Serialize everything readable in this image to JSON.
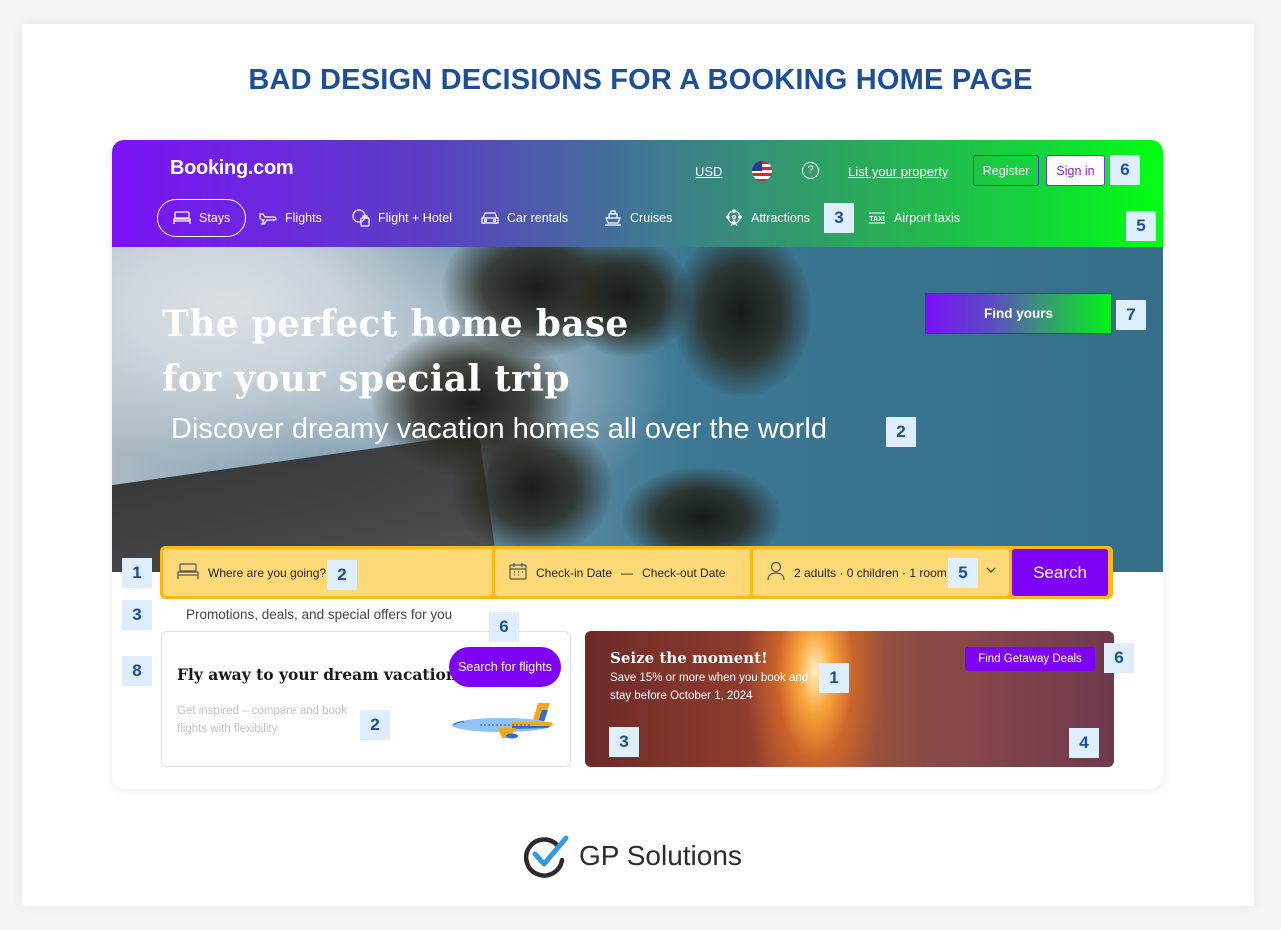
{
  "page_title": "BAD DESIGN DECISIONS FOR A BOOKING HOME PAGE",
  "header": {
    "logo": "Booking.com",
    "currency": "USD",
    "language_icon": "us-flag-icon",
    "help_icon": "question-circle-icon",
    "help_glyph": "?",
    "list_property": "List your property",
    "register": "Register",
    "sign_in": "Sign in"
  },
  "nav": {
    "items": [
      {
        "label": "Stays",
        "icon": "bed-icon",
        "active": true
      },
      {
        "label": "Flights",
        "icon": "plane-icon",
        "active": false
      },
      {
        "label": "Flight + Hotel",
        "icon": "flight-hotel-icon",
        "active": false
      },
      {
        "label": "Car rentals",
        "icon": "car-icon",
        "active": false
      },
      {
        "label": "Cruises",
        "icon": "ship-icon",
        "active": false
      },
      {
        "label": "Attractions",
        "icon": "ferris-wheel-icon",
        "active": false
      },
      {
        "label": "Airport taxis",
        "icon": "taxi-icon",
        "active": false
      }
    ]
  },
  "hero": {
    "headline_line1": "The perfect home base",
    "headline_line2": "for your special trip",
    "subtitle": "Discover dreamy vacation homes all over the world",
    "cta": "Find yours"
  },
  "search": {
    "destination_placeholder": "Where are you going?",
    "checkin_placeholder": "Check-in Date",
    "date_separator": "—",
    "checkout_placeholder": "Check-out Date",
    "guests": "2 adults · 0 children · 1 room",
    "button": "Search"
  },
  "promotions": {
    "heading": "Promotions, deals, and special offers for you",
    "flight_card": {
      "title": "Fly away to your dream vacation",
      "subtitle": "Get inspired – compare and book flights with flexibility",
      "button": "Search for flights"
    },
    "deal_card": {
      "title": "Seize the moment!",
      "subtitle": "Save 15% or more when you book and stay before October 1, 2024",
      "button": "Find Getaway Deals"
    }
  },
  "annotations": {
    "nav_attractions": "3",
    "header_signin": "6",
    "header_right": "5",
    "hero_cta": "7",
    "hero_subtitle": "2",
    "search_left": "1",
    "search_dest": "2",
    "search_guests": "5",
    "promo_heading": "3",
    "flight_card_left": "8",
    "flight_button": "6",
    "flight_subtitle": "2",
    "deal_text": "1",
    "deal_button": "6",
    "deal_bottom_left": "3",
    "deal_bottom_right": "4"
  },
  "colors": {
    "brand_purple": "#7e02f5",
    "search_border": "#fdb913",
    "search_field": "#fed978",
    "annotation_bg": "#deeefc",
    "annotation_text": "#1d4f99",
    "header_gradient_start": "#7b12f7",
    "header_gradient_end": "#00ff12"
  },
  "footer": {
    "brand": "GP Solutions"
  }
}
